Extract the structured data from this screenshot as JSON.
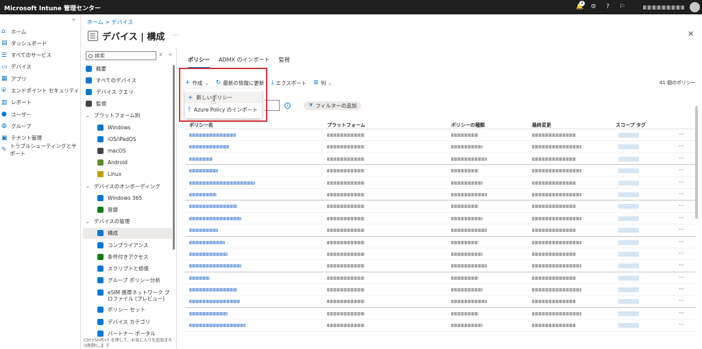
{
  "topbar": {
    "app_title": "Microsoft Intune 管理センター",
    "notification_count": "2",
    "tenant_name": "████████████"
  },
  "leftnav": {
    "items": [
      {
        "label": "ホーム",
        "icon": "home-icon",
        "color": "#0078d4"
      },
      {
        "label": "ダッシュボード",
        "icon": "dashboard-icon",
        "color": "#0078d4"
      },
      {
        "label": "すべてのサービス",
        "icon": "list-icon",
        "color": "#0078d4"
      },
      {
        "label": "デバイス",
        "icon": "devices-icon",
        "color": "#0078d4"
      },
      {
        "label": "アプリ",
        "icon": "apps-icon",
        "color": "#0078d4"
      },
      {
        "label": "エンドポイント セキュリティ",
        "icon": "shield-icon",
        "color": "#0078d4"
      },
      {
        "label": "レポート",
        "icon": "reports-icon",
        "color": "#0078d4"
      },
      {
        "label": "ユーザー",
        "icon": "user-icon",
        "color": "#0078d4"
      },
      {
        "label": "グループ",
        "icon": "group-icon",
        "color": "#0078d4"
      },
      {
        "label": "テナント管理",
        "icon": "tenant-icon",
        "color": "#0078d4"
      },
      {
        "label": "トラブルシューティングとサポート",
        "icon": "wrench-icon",
        "color": "#0078d4"
      }
    ]
  },
  "breadcrumb": "ホーム > デバイス",
  "page": {
    "title": "デバイス | 構成"
  },
  "subnav": {
    "search_placeholder": "検索",
    "items": [
      {
        "label": "概要",
        "type": "item",
        "indent": 0
      },
      {
        "label": "すべてのデバイス",
        "type": "item",
        "indent": 0
      },
      {
        "label": "デバイス クエリ",
        "type": "item",
        "indent": 0
      },
      {
        "label": "監視",
        "type": "item",
        "indent": 0
      },
      {
        "label": "プラットフォーム別",
        "type": "group",
        "indent": 0
      },
      {
        "label": "Windows",
        "type": "item",
        "indent": 1
      },
      {
        "label": "iOS/iPadOS",
        "type": "item",
        "indent": 1
      },
      {
        "label": "macOS",
        "type": "item",
        "indent": 1
      },
      {
        "label": "Android",
        "type": "item",
        "indent": 1
      },
      {
        "label": "Linux",
        "type": "item",
        "indent": 1
      },
      {
        "label": "デバイスのオンボーディング",
        "type": "group",
        "indent": 0
      },
      {
        "label": "Windows 365",
        "type": "item",
        "indent": 1
      },
      {
        "label": "登録",
        "type": "item",
        "indent": 1
      },
      {
        "label": "デバイスの管理",
        "type": "group",
        "indent": 0
      },
      {
        "label": "構成",
        "type": "item",
        "indent": 1,
        "active": true
      },
      {
        "label": "コンプライアンス",
        "type": "item",
        "indent": 1
      },
      {
        "label": "条件付きアクセス",
        "type": "item",
        "indent": 1
      },
      {
        "label": "スクリプトと修復",
        "type": "item",
        "indent": 1
      },
      {
        "label": "グループ ポリシー分析",
        "type": "item",
        "indent": 1
      },
      {
        "label": "eSIM 携帯ネットワーク プロファイル (プレビュー)",
        "type": "item",
        "indent": 1
      },
      {
        "label": "ポリシー セット",
        "type": "item",
        "indent": 1
      },
      {
        "label": "デバイス カテゴリ",
        "type": "item",
        "indent": 1
      },
      {
        "label": "パートナー ポータル",
        "type": "item",
        "indent": 1
      }
    ],
    "hint": "Ctrl+Shift+F を押して、お気に入りを追加または削除しま す"
  },
  "tabs": [
    {
      "label": "ポリシー",
      "active": true
    },
    {
      "label": "ADMX のインポート",
      "active": false
    },
    {
      "label": "監視",
      "active": false
    }
  ],
  "toolbar": {
    "create_label": "作成",
    "refresh_label": "最新の情報に更新",
    "export_label": "エクスポート",
    "columns_label": "列",
    "policy_count": "41 個のポリシー"
  },
  "dropdown": {
    "items": [
      {
        "label": "新しいポリシー",
        "icon": "plus-icon"
      },
      {
        "label": "Azure Policy のインポート",
        "icon": "upload-icon"
      }
    ]
  },
  "filter": {
    "add_filter_label": "フィルターの追加"
  },
  "table": {
    "headers": [
      "ポリシー名",
      "プラットフォーム",
      "ポリシーの種類",
      "最終変更",
      "スコープ タグ"
    ],
    "row_count": 17,
    "note": "cell contents blurred in screenshot"
  },
  "colors": {
    "accent": "#0078d4",
    "highlight": "#d13438",
    "topbar": "#1f1f1f"
  }
}
